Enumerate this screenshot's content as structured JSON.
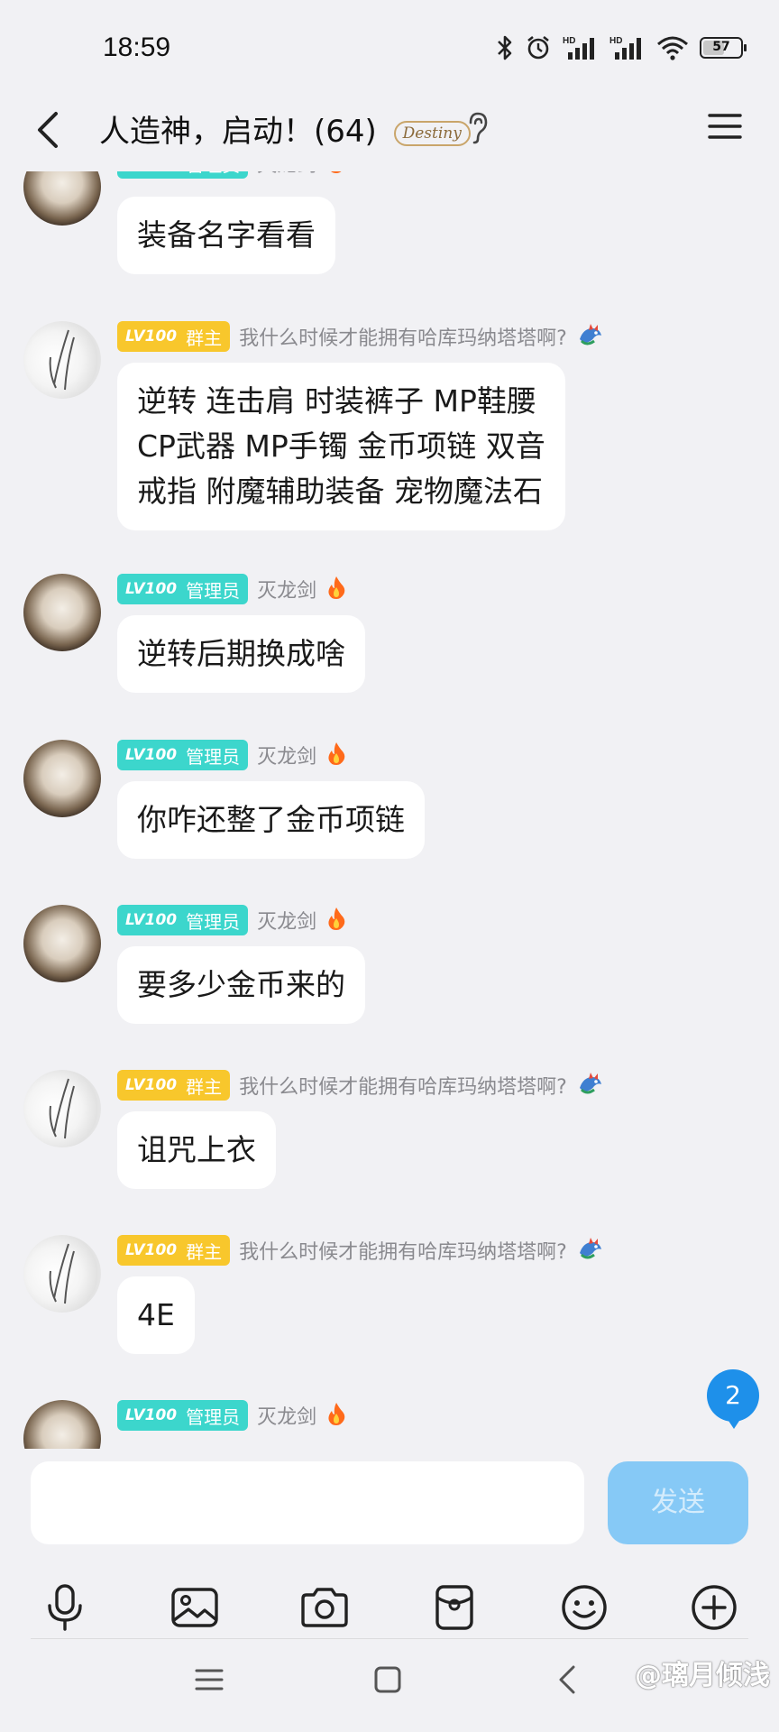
{
  "status_bar": {
    "time": "18:59",
    "battery": "57",
    "battery_fraction": 0.57,
    "icons": [
      "bluetooth-icon",
      "alarm-icon",
      "hd-signal-icon",
      "hd-signal-icon",
      "wifi-icon",
      "battery-icon"
    ]
  },
  "header": {
    "title": "人造神，启动！(64)",
    "destiny_badge": "Destiny",
    "back_icon": "chevron-left-icon",
    "menu_icon": "hamburger-menu-icon"
  },
  "roles": {
    "admin": {
      "level": "LV100",
      "title": "管理员",
      "color": "#3cd6cc"
    },
    "owner": {
      "level": "LV100",
      "title": "群主",
      "color": "#f8c72c"
    }
  },
  "senders": {
    "admin": "灭龙剑",
    "owner": "我什么时候才能拥有哈库玛纳塔塔啊?"
  },
  "messages": [
    {
      "role": "admin",
      "text": [
        "装备名字看看"
      ]
    },
    {
      "role": "owner",
      "text": [
        "逆转 连击肩 时装裤子 MP鞋腰",
        "CP武器  MP手镯  金币项链  双音",
        "戒指  附魔辅助装备  宠物魔法石"
      ]
    },
    {
      "role": "admin",
      "text": [
        "逆转后期换成啥"
      ]
    },
    {
      "role": "admin",
      "text": [
        "你咋还整了金币项链"
      ]
    },
    {
      "role": "admin",
      "text": [
        "要多少金币来的"
      ]
    },
    {
      "role": "owner",
      "text": [
        "诅咒上衣"
      ]
    },
    {
      "role": "owner",
      "text": [
        "4E"
      ]
    },
    {
      "role": "admin",
      "text": []
    }
  ],
  "unread_count": "2",
  "composer": {
    "input_value": "",
    "send_label": "发送",
    "tools": [
      "microphone-icon",
      "image-icon",
      "camera-icon",
      "red-packet-icon",
      "emoji-icon",
      "plus-icon"
    ]
  },
  "nav": {
    "items": [
      "recents-icon",
      "home-icon",
      "back-icon"
    ]
  },
  "watermark": "@璃月倾浅",
  "colors": {
    "background": "#f1f1f4",
    "send_button": "#86c9f6",
    "unread_badge": "#1e90ea"
  }
}
